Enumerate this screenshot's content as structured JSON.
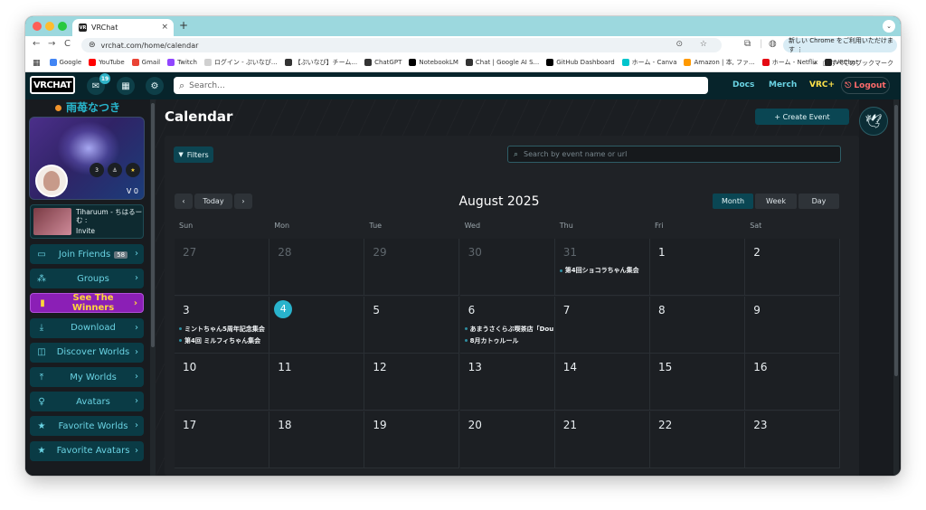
{
  "browser": {
    "tab_title": "VRChat",
    "tab_favicon": "VR",
    "tab_close": "×",
    "new_tab": "+",
    "tab_menu": "⌄",
    "url": "vrchat.com/home/calendar",
    "nav_back": "←",
    "nav_forward": "→",
    "nav_reload": "C",
    "site_info": "⊜",
    "omnibox_icons": "⊙ ☆",
    "ext_icons": [
      "⧉",
      "|",
      "◍"
    ],
    "update_banner": "新しい Chrome をご利用いただけます ⋮",
    "bookmarks": [
      {
        "label": "Google",
        "color": "#4285f4"
      },
      {
        "label": "YouTube",
        "color": "#ff0000"
      },
      {
        "label": "Gmail",
        "color": "#ea4335"
      },
      {
        "label": "Twitch",
        "color": "#9146ff"
      },
      {
        "label": "ログイン - ぷいなぴ...",
        "color": "#d0d0d0"
      },
      {
        "label": "【ぷいなぴ】チーム...",
        "color": "#333333"
      },
      {
        "label": "ChatGPT",
        "color": "#333333"
      },
      {
        "label": "NotebookLM",
        "color": "#000000"
      },
      {
        "label": "Chat | Google AI S...",
        "color": "#333333"
      },
      {
        "label": "GitHub Dashboard",
        "color": "#000000"
      },
      {
        "label": "ホーム - Canva",
        "color": "#00c4cc"
      },
      {
        "label": "Amazon | 本, ファ...",
        "color": "#ff9900"
      },
      {
        "label": "ホーム - Netflix",
        "color": "#e50914"
      },
      {
        "label": "VRChat",
        "color": "#222222"
      }
    ],
    "bookmarks_more": "»",
    "all_bookmarks": "□ すべてのブックマーク"
  },
  "nav": {
    "logo": "VRCHAT",
    "mail_icon": "✉",
    "notification_count": "19",
    "calendar_icon": "▦",
    "settings_icon": "⚙",
    "search_icon": "⌕",
    "search_placeholder": "Search...",
    "docs": "Docs",
    "merch": "Merch",
    "vrc_plus": "VRC+",
    "logout": "Logout",
    "logout_icon": "⎋"
  },
  "profile": {
    "username": "雨苺なつき",
    "status_color": "#f0932b",
    "mini_stats": [
      "3",
      "⚓",
      "★"
    ],
    "credits": "V 0"
  },
  "invite": {
    "title": "Tiharuum - ちはるーむ :",
    "action": "Invite"
  },
  "sidebar": {
    "items": [
      {
        "label": "Join Friends",
        "icon": "▭",
        "count": "58",
        "chev": "›"
      },
      {
        "label": "Groups",
        "icon": "⁂",
        "chev": "›"
      },
      {
        "label": "See The Winners",
        "icon": "▮",
        "chev": "›"
      },
      {
        "label": "Download",
        "icon": "⤓",
        "chev": "›"
      },
      {
        "label": "Discover Worlds",
        "icon": "◫",
        "chev": "›"
      },
      {
        "label": "My Worlds",
        "icon": "⤒",
        "chev": "›"
      },
      {
        "label": "Avatars",
        "icon": "♀",
        "chev": "›"
      },
      {
        "label": "Favorite Worlds",
        "icon": "★",
        "chev": "›"
      },
      {
        "label": "Favorite Avatars",
        "icon": "★",
        "chev": "›"
      }
    ]
  },
  "calendar": {
    "page_title": "Calendar",
    "create_event": "+ Create Event",
    "filters": "Filters",
    "filter_icon": "▼",
    "search_placeholder": "Search by event name or url",
    "search_icon": "⌕",
    "prev": "‹",
    "today": "Today",
    "next": "›",
    "month_title": "August 2025",
    "views": [
      "Month",
      "Week",
      "Day"
    ],
    "active_view": "Month",
    "days_of_week": [
      "Sun",
      "Mon",
      "Tue",
      "Wed",
      "Thu",
      "Fri",
      "Sat"
    ],
    "weeks": [
      [
        {
          "d": "27",
          "other": true,
          "events": []
        },
        {
          "d": "28",
          "other": true,
          "events": []
        },
        {
          "d": "29",
          "other": true,
          "events": []
        },
        {
          "d": "30",
          "other": true,
          "events": []
        },
        {
          "d": "31",
          "other": true,
          "events": [
            "第4回ショコラちゃん集会"
          ]
        },
        {
          "d": "1",
          "events": []
        },
        {
          "d": "2",
          "events": []
        }
      ],
      [
        {
          "d": "3",
          "events": [
            "ミントちゃん5周年記念集会",
            "第4回 ミルフィちゃん集会"
          ]
        },
        {
          "d": "4",
          "today": true,
          "events": []
        },
        {
          "d": "5",
          "events": []
        },
        {
          "d": "6",
          "events": [
            "あまうさくらぶ喫茶店「Dou",
            "8月カトゥルール"
          ]
        },
        {
          "d": "7",
          "events": []
        },
        {
          "d": "8",
          "events": []
        },
        {
          "d": "9",
          "events": []
        }
      ],
      [
        {
          "d": "10",
          "events": []
        },
        {
          "d": "11",
          "events": []
        },
        {
          "d": "12",
          "events": []
        },
        {
          "d": "13",
          "events": []
        },
        {
          "d": "14",
          "events": []
        },
        {
          "d": "15",
          "events": []
        },
        {
          "d": "16",
          "events": []
        }
      ],
      [
        {
          "d": "17",
          "events": []
        },
        {
          "d": "18",
          "events": []
        },
        {
          "d": "19",
          "events": []
        },
        {
          "d": "20",
          "events": []
        },
        {
          "d": "21",
          "events": []
        },
        {
          "d": "22",
          "events": []
        },
        {
          "d": "23",
          "events": []
        }
      ]
    ]
  },
  "right_rail": {
    "bird_icon": "🕊"
  }
}
